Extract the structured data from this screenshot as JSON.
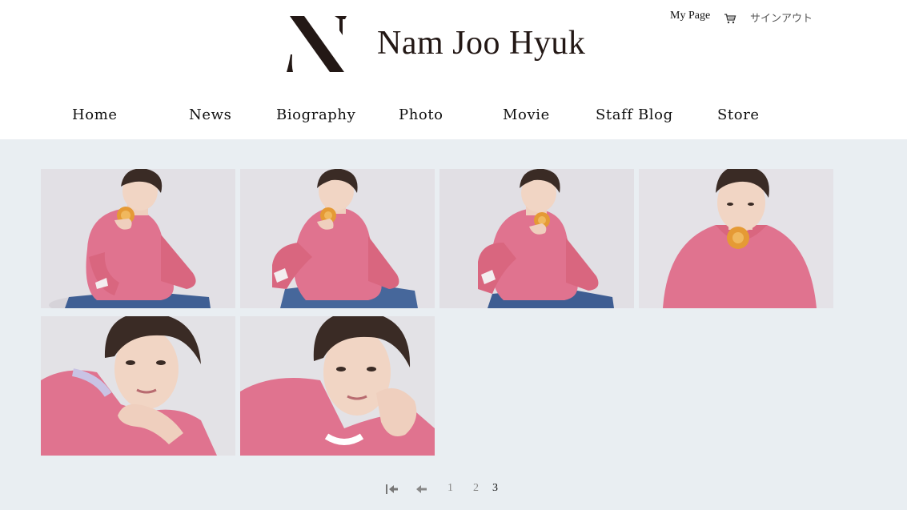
{
  "brand": {
    "name": "Nam Joo Hyuk",
    "mark_letter": "N",
    "color": "#231815"
  },
  "utility_nav": {
    "my_page": "My Page",
    "cart_icon": "cart-icon",
    "sign_out": "サインアウト"
  },
  "nav": {
    "items": [
      {
        "label": "Home"
      },
      {
        "label": "News"
      },
      {
        "label": "Biography"
      },
      {
        "label": "Photo"
      },
      {
        "label": "Movie"
      },
      {
        "label": "Staff Blog"
      },
      {
        "label": "Store"
      }
    ]
  },
  "gallery": {
    "background": "#e9eef2",
    "sweater_color": "#e0738f",
    "photos": [
      {
        "pose": "sitting-eating"
      },
      {
        "pose": "sitting-eating"
      },
      {
        "pose": "sitting-eating"
      },
      {
        "pose": "closeup-eating"
      },
      {
        "pose": "portrait-hand-chin"
      },
      {
        "pose": "portrait-hand-cheek"
      }
    ]
  },
  "pagination": {
    "first_icon": "first-page-icon",
    "prev_icon": "previous-page-icon",
    "pages": [
      "1",
      "2",
      "3"
    ],
    "current": "3"
  }
}
